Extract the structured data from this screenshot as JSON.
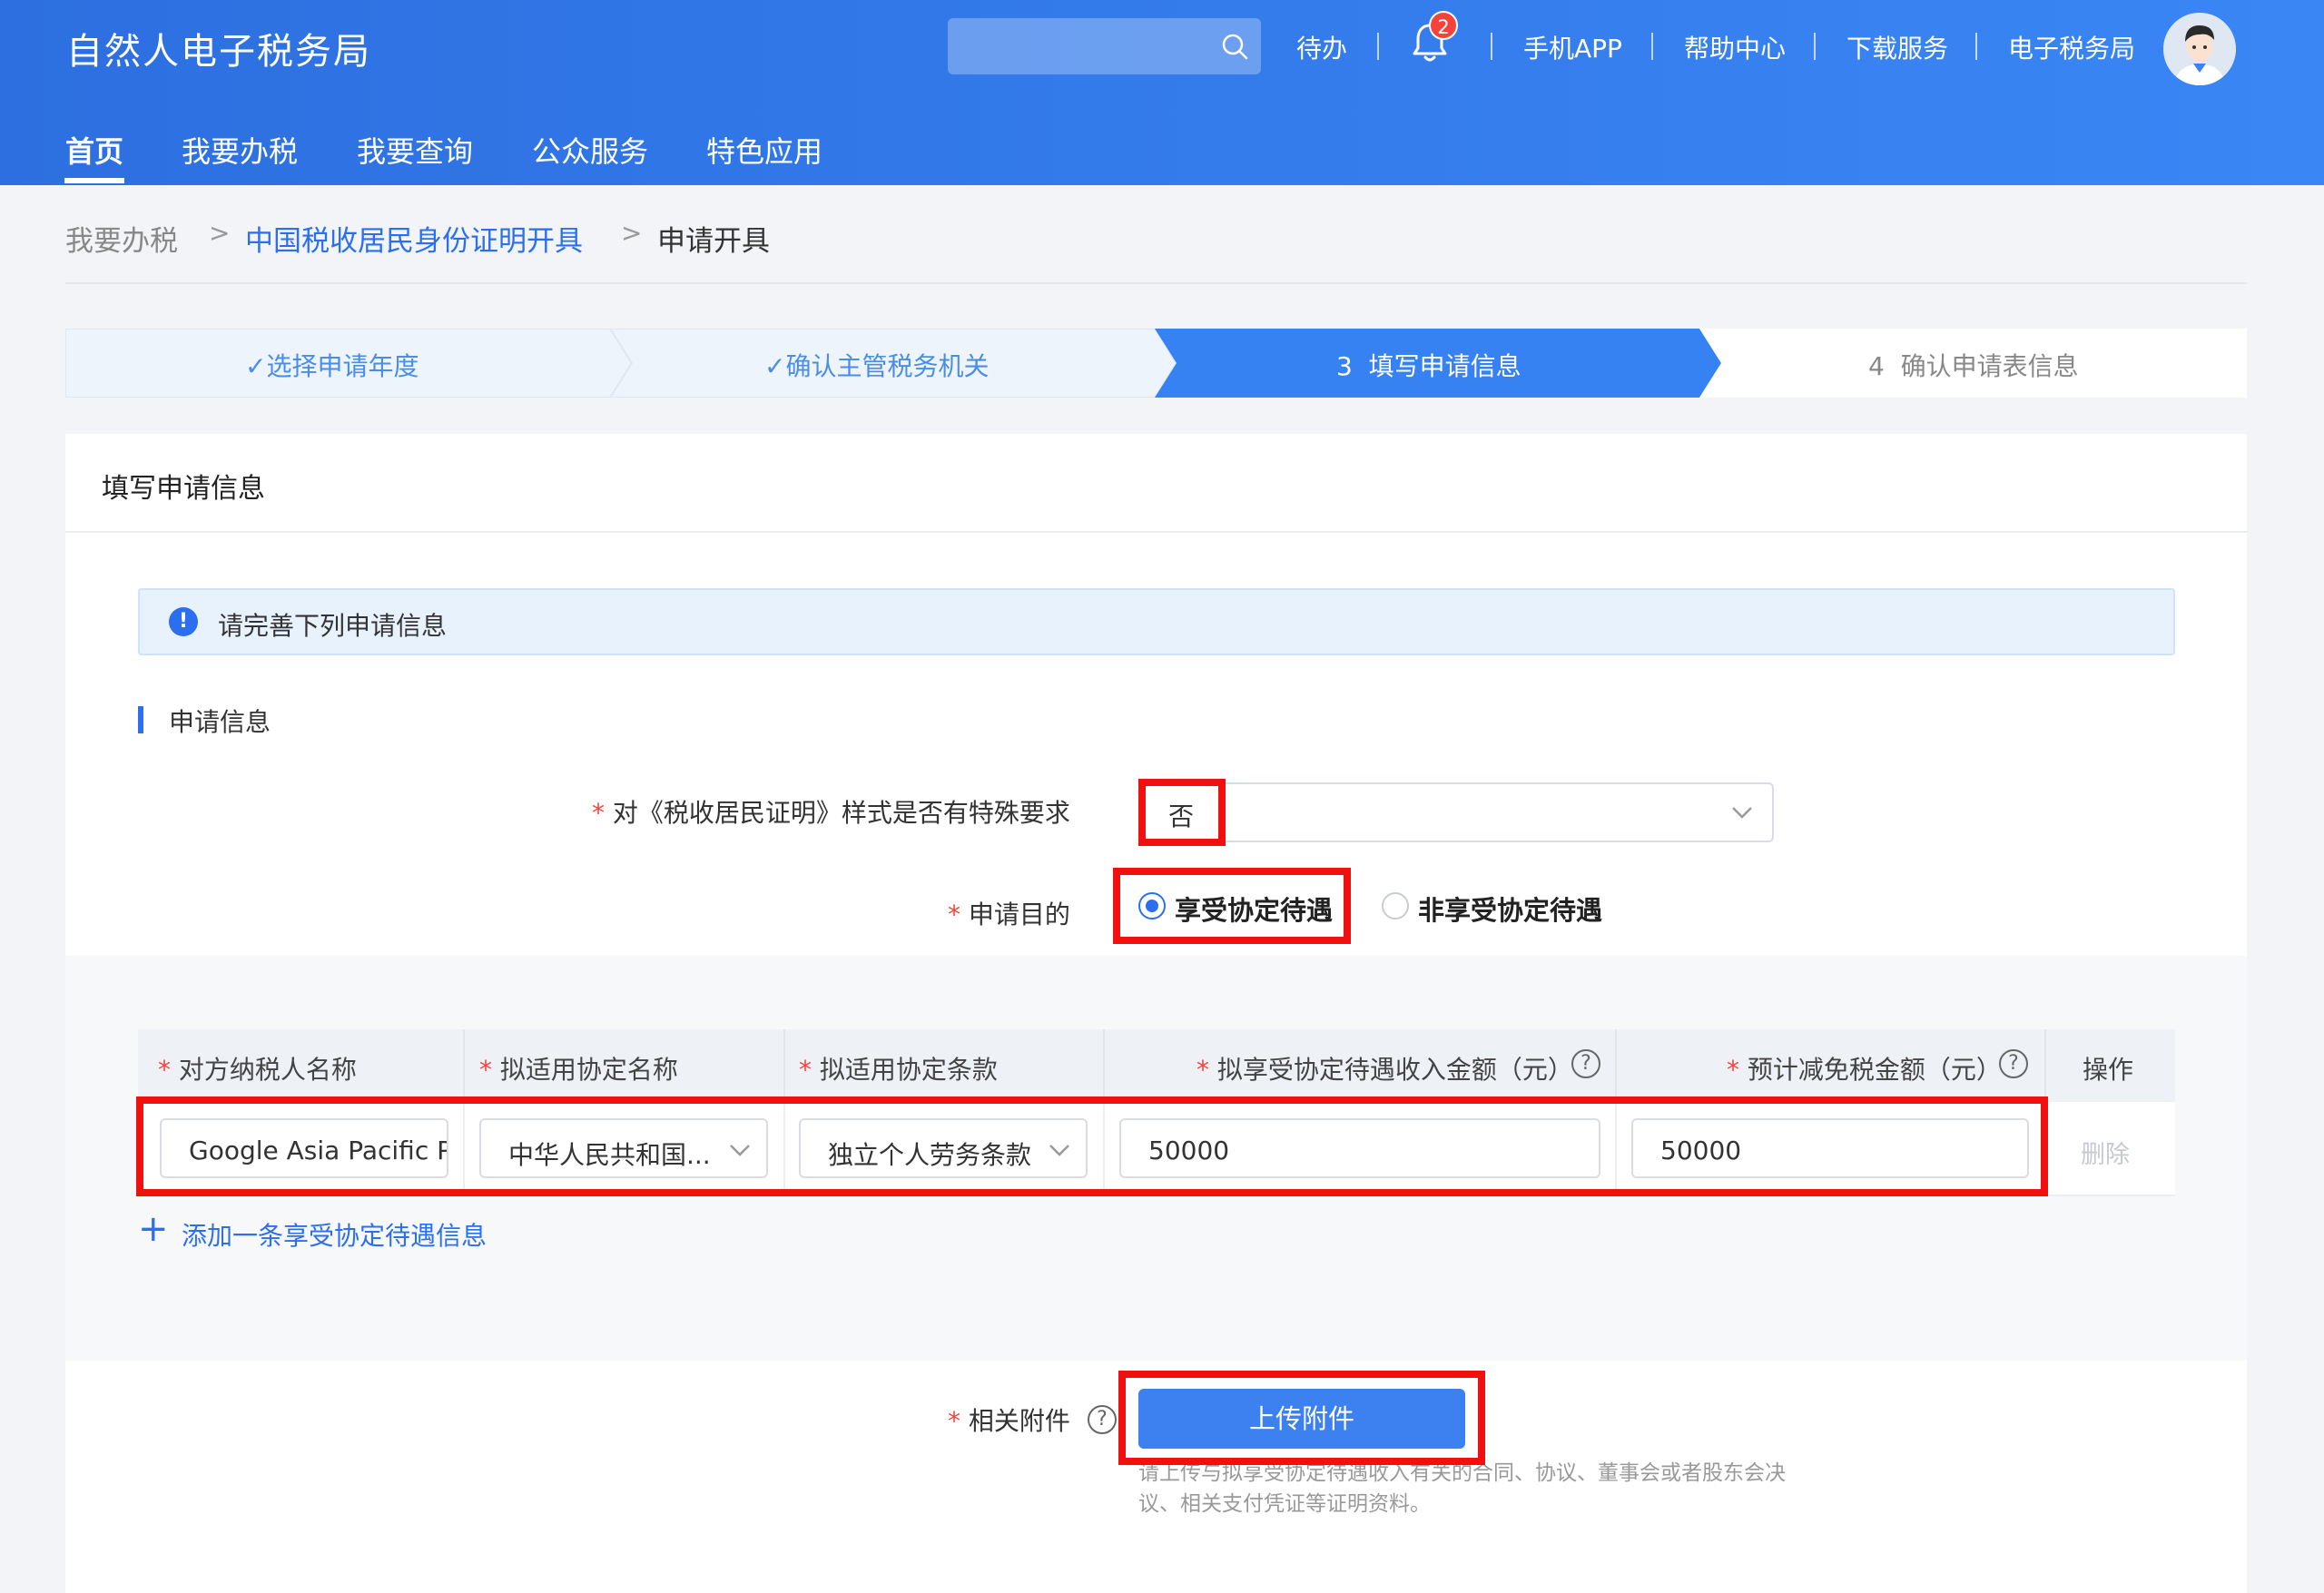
{
  "header": {
    "brand": "自然人电子税务局",
    "nav_links": [
      "待办",
      "手机APP",
      "帮助中心",
      "下载服务",
      "电子税务局"
    ],
    "notification_count": "2",
    "main_nav": [
      "首页",
      "我要办税",
      "我要查询",
      "公众服务",
      "特色应用"
    ],
    "active_nav": "首页"
  },
  "breadcrumb": {
    "items": [
      "我要办税",
      "中国税收居民身份证明开具",
      "申请开具"
    ],
    "separator": ">"
  },
  "steps": [
    {
      "label": "选择申请年度",
      "status": "done"
    },
    {
      "label": "确认主管税务机关",
      "status": "done"
    },
    {
      "number": "3",
      "label": "填写申请信息",
      "status": "active"
    },
    {
      "number": "4",
      "label": "确认申请表信息",
      "status": "pending"
    }
  ],
  "card": {
    "title": "填写申请信息",
    "alert": "请完善下列申请信息",
    "section_title": "申请信息"
  },
  "form": {
    "required_mark": "*",
    "special_req_label": "对《税收居民证明》样式是否有特殊要求",
    "special_req_value": "否",
    "purpose_label": "申请目的",
    "purpose_options": [
      "享受协定待遇",
      "非享受协定待遇"
    ],
    "purpose_selected": "享受协定待遇",
    "attachment_label": "相关附件",
    "upload_button": "上传附件",
    "upload_hint": "请上传与拟享受协定待遇收入有关的合同、协议、董事会或者股东会决议、相关支付凭证等证明资料。"
  },
  "table": {
    "headers": [
      "对方纳税人名称",
      "拟适用协定名称",
      "拟适用协定条款",
      "拟享受协定待遇收入金额（元）",
      "预计减免税金额（元）",
      "操作"
    ],
    "rows": [
      {
        "counterparty": "Google Asia Pacific Pte. Ltd.",
        "treaty": "中华人民共和国...",
        "clause": "独立个人劳务条款",
        "income": "50000",
        "reduction": "50000",
        "action": "删除"
      }
    ],
    "add_link": "添加一条享受协定待遇信息"
  },
  "colors": {
    "primary": "#2b6ff0",
    "highlight": "#f01010",
    "required": "#f5433b"
  }
}
